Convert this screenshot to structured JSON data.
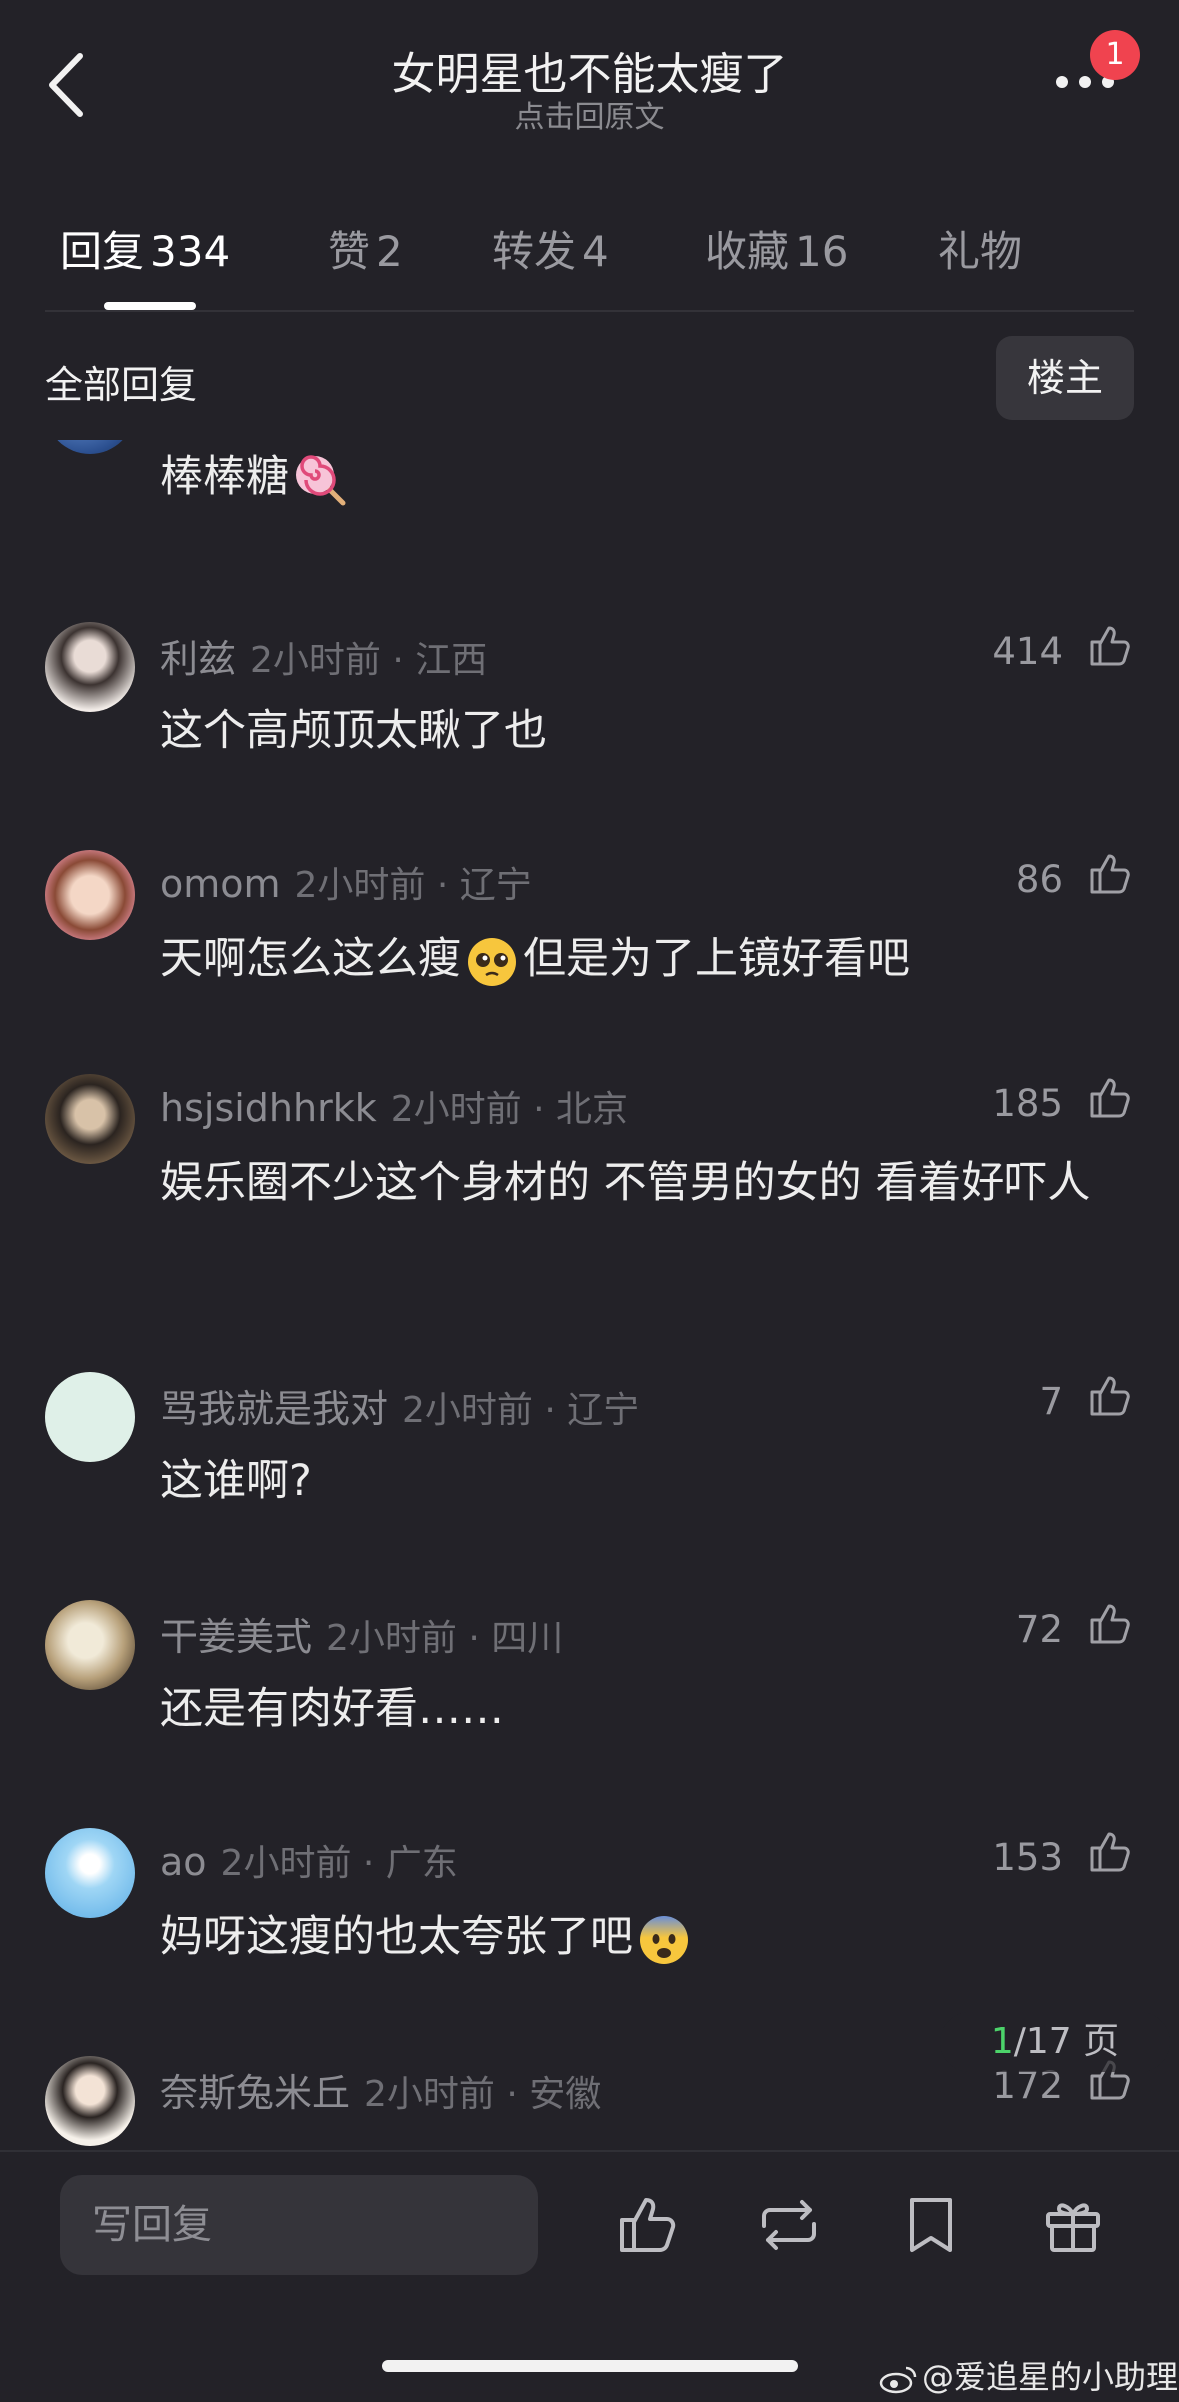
{
  "header": {
    "title": "女明星也不能太瘦了",
    "subtitle": "点击回原文",
    "notification_badge": "1"
  },
  "tabs": [
    {
      "label": "回复",
      "count": "334",
      "active": true
    },
    {
      "label": "赞",
      "count": "2",
      "active": false
    },
    {
      "label": "转发",
      "count": "4",
      "active": false
    },
    {
      "label": "收藏",
      "count": "16",
      "active": false
    },
    {
      "label": "礼物",
      "count": "",
      "active": false
    }
  ],
  "filter": {
    "label": "全部回复",
    "op_button": "楼主"
  },
  "comments": [
    {
      "user": "",
      "info": "",
      "likes": "",
      "text": "棒棒糖",
      "emoji": "lollipop-icon"
    },
    {
      "user": "利兹",
      "info": "2小时前 · 江西",
      "likes": "414",
      "text": "这个高颅顶太瞅了也"
    },
    {
      "user": "omom",
      "info": "2小时前 · 辽宁",
      "likes": "86",
      "text_before": "天啊怎么这么瘦",
      "emoji": "pleading-face-icon",
      "text_after": "但是为了上镜好看吧"
    },
    {
      "user": "hsjsidhhrkk",
      "info": "2小时前 · 北京",
      "likes": "185",
      "text": "娱乐圈不少这个身材的 不管男的女的 看着好吓人"
    },
    {
      "user": "骂我就是我对",
      "info": "2小时前 · 辽宁",
      "likes": "7",
      "text": "这谁啊?"
    },
    {
      "user": "干姜美式",
      "info": "2小时前 · 四川",
      "likes": "72",
      "text": "还是有肉好看……"
    },
    {
      "user": "ao",
      "info": "2小时前 · 广东",
      "likes": "153",
      "text": "妈呀这瘦的也太夸张了吧",
      "emoji": "fearful-face-icon"
    },
    {
      "user": "奈斯兔米丘",
      "info": "2小时前 · 安徽",
      "likes": "172",
      "text": ""
    }
  ],
  "pagination": {
    "current": "1",
    "rest": "/17 页"
  },
  "bottom_bar": {
    "reply_placeholder": "写回复",
    "icons": [
      "like-icon",
      "repost-icon",
      "bookmark-icon",
      "gift-icon"
    ]
  },
  "watermark": "@爱追星的小助理",
  "colors": {
    "background": "#232228",
    "badge": "#f0434f",
    "page_current": "#4cd36a"
  }
}
